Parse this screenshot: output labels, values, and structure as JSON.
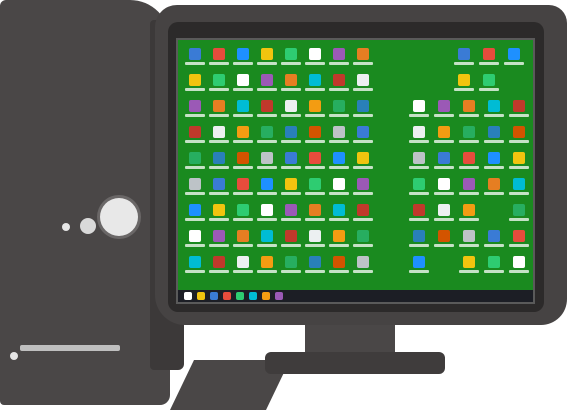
{
  "colors": {
    "case": "#4a4747",
    "screen": "#1a8a1f",
    "taskbar": "#1c1e25"
  },
  "desktop_icon_colors": [
    "#3a7bd5",
    "#e74c3c",
    "#1e90ff",
    "#f1c40f",
    "#2ecc71",
    "#ffffff",
    "#9b59b6",
    "#e67e22",
    "#00bcd4",
    "#c0392b",
    "#ecf0f1",
    "#f39c12",
    "#27ae60",
    "#2980b9",
    "#d35400",
    "#bdc3c7"
  ],
  "taskbar_icon_colors": [
    "#ffffff",
    "#f1c40f",
    "#3a7bd5",
    "#e74c3c",
    "#2ecc71",
    "#00bcd4",
    "#f39c12",
    "#9b59b6"
  ]
}
